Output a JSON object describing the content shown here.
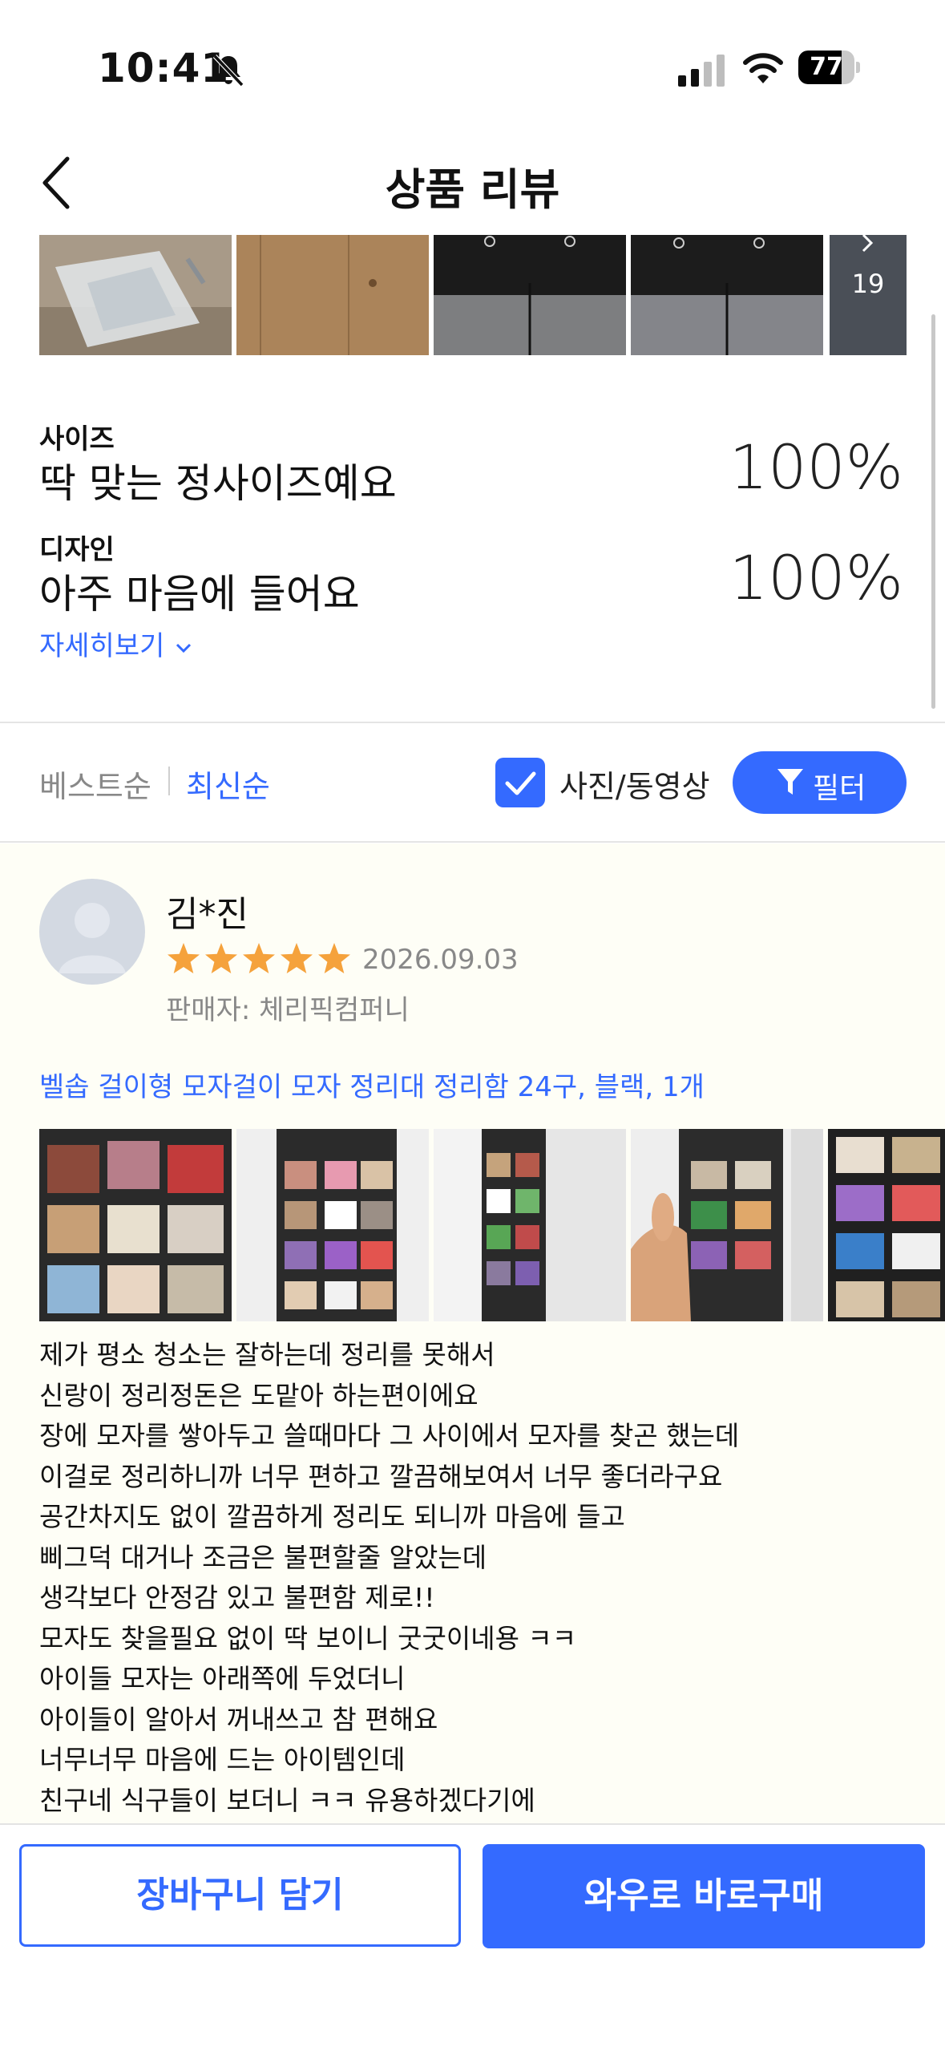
{
  "status": {
    "time": "10:41",
    "battery": "77",
    "battery_level": 0.77
  },
  "nav": {
    "title": "상품 리뷰"
  },
  "thumbnails": {
    "more_count": "19"
  },
  "stats": [
    {
      "label": "사이즈",
      "text": "딱 맞는 정사이즈예요",
      "percent": "100%"
    },
    {
      "label": "디자인",
      "text": "아주 마음에 들어요",
      "percent": "100%"
    }
  ],
  "more_link": "자세히보기",
  "sort": {
    "best": "베스트순",
    "latest": "최신순",
    "photo_video": "사진/동영상",
    "filter": "필터"
  },
  "review": {
    "author": "김*진",
    "rating": 5,
    "date": "2026.09.03",
    "seller": "판매자: 체리픽컴퍼니",
    "product_option": "벨솝 걸이형 모자걸이 모자 정리대 정리함 24구, 블랙, 1개",
    "text": "제가 평소 청소는 잘하는데 정리를 못해서\n신랑이 정리정돈은 도맡아 하는편이에요\n장에 모자를 쌓아두고 쓸때마다 그 사이에서 모자를 찾곤 했는데\n이걸로 정리하니까 너무 편하고 깔끔해보여서 너무 좋더라구요\n공간차지도 없이 깔끔하게 정리도 되니까 마음에 들고\n삐그덕 대거나 조금은 불편할줄 알았는데\n생각보다 안정감 있고 불편함 제로!!\n모자도 찾을필요 없이 딱 보이니 굿굿이네용 ㅋㅋ\n아이들 모자는 아래쪽에 두었더니\n아이들이 알아서 꺼내쓰고 참 편해요\n너무너무 마음에 드는 아이템인데\n친구네 식구들이 보더니 ㅋㅋ 유용하겠다기에"
  },
  "actions": {
    "cart": "장바구니 담기",
    "buy": "와우로 바로구매"
  },
  "colors": {
    "accent": "#346aff",
    "star": "#f5a23c",
    "review_bg": "#fefef6"
  }
}
